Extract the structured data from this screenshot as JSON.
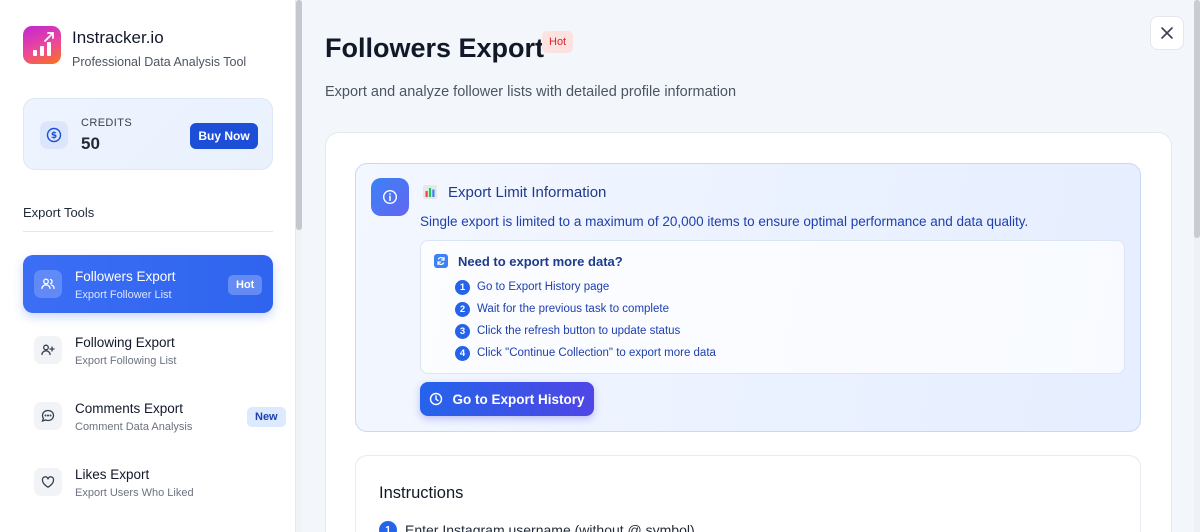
{
  "brand": {
    "name": "Instracker.io",
    "subtitle": "Professional Data Analysis Tool",
    "logo_icon": "bar-chart-trend-icon",
    "logo_colors": [
      "#c026d3",
      "#ec4899",
      "#f97316"
    ]
  },
  "credits": {
    "label": "CREDITS",
    "value": "50",
    "buy_label": "Buy Now",
    "icon": "dollar-coin-icon"
  },
  "sidebar": {
    "section_title": "Export Tools",
    "items": [
      {
        "label": "Followers Export",
        "sub": "Export Follower List",
        "badge": "Hot",
        "icon": "users-icon",
        "active": true
      },
      {
        "label": "Following Export",
        "sub": "Export Following List",
        "badge": "",
        "icon": "user-plus-icon",
        "active": false
      },
      {
        "label": "Comments Export",
        "sub": "Comment Data Analysis",
        "badge": "New",
        "icon": "message-icon",
        "active": false
      },
      {
        "label": "Likes Export",
        "sub": "Export Users Who Liked",
        "badge": "",
        "icon": "heart-icon",
        "active": false
      }
    ]
  },
  "main": {
    "title": "Followers Export",
    "tag": "Hot",
    "subtitle": "Export and analyze follower lists with detailed profile information",
    "close_icon": "close-icon"
  },
  "info": {
    "title": "Export Limit Information",
    "description": "Single export is limited to a maximum of 20,000 items to ensure optimal performance and data quality.",
    "steps_title": "Need to export more data?",
    "steps": [
      {
        "num": "1",
        "text": "Go to Export History page"
      },
      {
        "num": "2",
        "text": "Wait for the previous task to complete"
      },
      {
        "num": "3",
        "text": "Click the refresh button to update status"
      },
      {
        "num": "4",
        "text": "Click \"Continue Collection\" to export more data"
      }
    ],
    "button_label": "Go to Export History",
    "accent": "#2563eb"
  },
  "instructions": {
    "title": "Instructions",
    "steps": [
      {
        "num": "1",
        "text": "Enter Instagram username (without @ symbol)"
      }
    ]
  }
}
